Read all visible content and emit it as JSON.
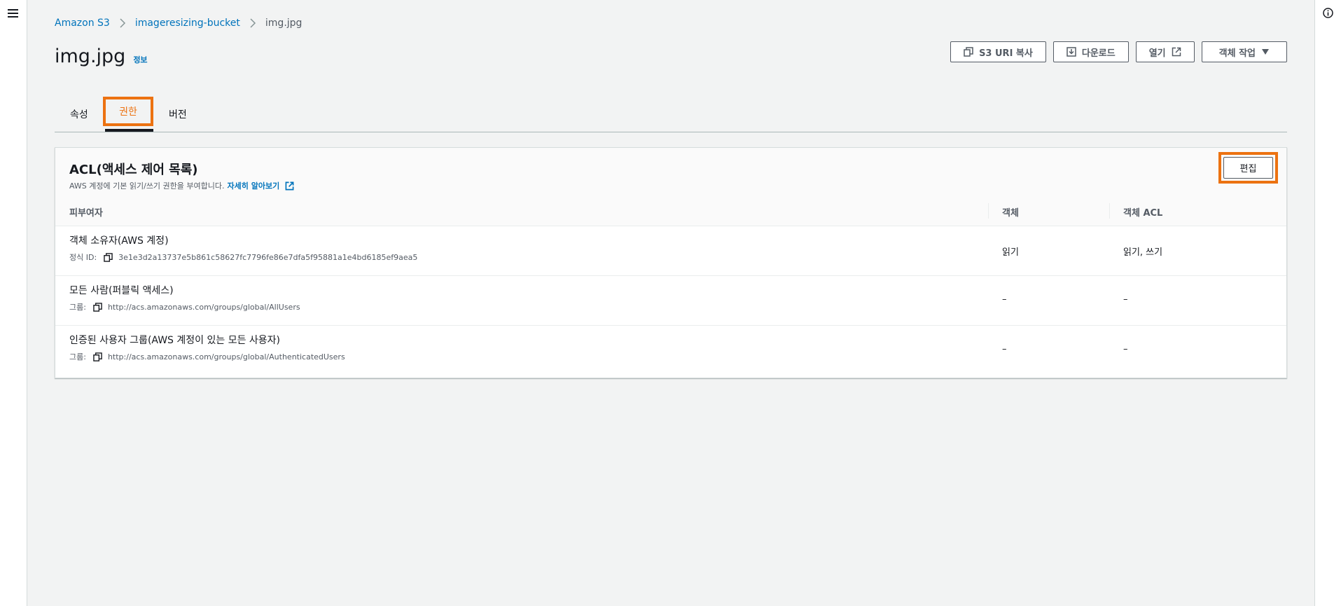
{
  "breadcrumb": {
    "items": [
      "Amazon S3",
      "imageresizing-bucket"
    ],
    "current": "img.jpg"
  },
  "page": {
    "title": "img.jpg",
    "info_link": "정보"
  },
  "actions": {
    "copy_uri": "S3 URI 복사",
    "download": "다운로드",
    "open": "열기",
    "object_actions": "객체 작업"
  },
  "tabs": [
    {
      "label": "속성",
      "active": false
    },
    {
      "label": "권한",
      "active": true
    },
    {
      "label": "버전",
      "active": false
    }
  ],
  "acl_panel": {
    "title": "ACL(액세스 제어 목록)",
    "description": "AWS 계정에 기본 읽기/쓰기 권한을 부여합니다.",
    "learn_more": "자세히 알아보기",
    "edit_label": "편집",
    "columns": [
      "피부여자",
      "객체",
      "객체 ACL"
    ],
    "rows": [
      {
        "grantee": "객체 소유자(AWS 계정)",
        "detail_label": "정식 ID:",
        "detail_value": "3e1e3d2a13737e5b861c58627fc7796fe86e7dfa5f95881a1e4bd6185ef9aea5",
        "object": "읽기",
        "object_acl": "읽기, 쓰기"
      },
      {
        "grantee": "모든 사람(퍼블릭 액세스)",
        "detail_label": "그룹:",
        "detail_value": "http://acs.amazonaws.com/groups/global/AllUsers",
        "object": "–",
        "object_acl": "–"
      },
      {
        "grantee": "인증된 사용자 그룹(AWS 계정이 있는 모든 사용자)",
        "detail_label": "그룹:",
        "detail_value": "http://acs.amazonaws.com/groups/global/AuthenticatedUsers",
        "object": "–",
        "object_acl": "–"
      }
    ]
  },
  "colors": {
    "link": "#0073bb",
    "highlight": "#ec7211",
    "background": "#f2f3f3"
  }
}
